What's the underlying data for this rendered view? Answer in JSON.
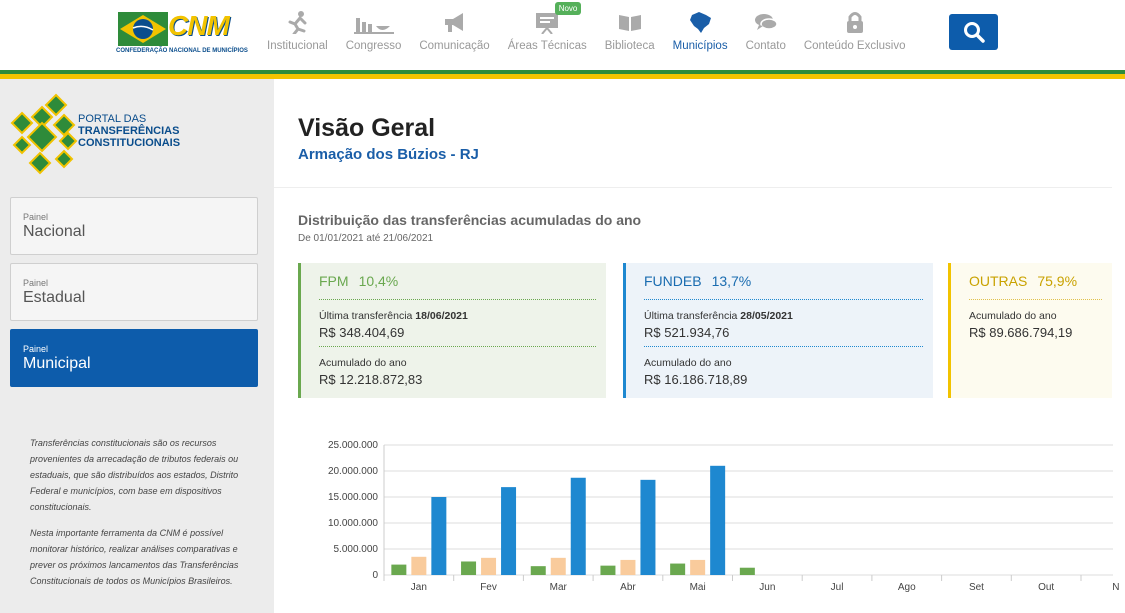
{
  "header": {
    "logo": {
      "text": "CNM",
      "subtitle": "CONFEDERAÇÃO NACIONAL DE MUNICÍPIOS"
    },
    "nav": [
      {
        "label": "Institucional",
        "icon": "person-running-icon"
      },
      {
        "label": "Congresso",
        "icon": "congress-icon"
      },
      {
        "label": "Comunicação",
        "icon": "megaphone-icon"
      },
      {
        "label": "Áreas Técnicas",
        "icon": "presentation-board-icon",
        "badge": "Novo"
      },
      {
        "label": "Biblioteca",
        "icon": "book-icon"
      },
      {
        "label": "Municípios",
        "icon": "brazil-map-icon",
        "active": true
      },
      {
        "label": "Contato",
        "icon": "chat-bubbles-icon"
      },
      {
        "label": "Conteúdo Exclusivo",
        "icon": "lock-icon"
      }
    ],
    "search_icon": "search-icon",
    "colors": {
      "brand_blue": "#0d5cab",
      "green": "#2e8b3a",
      "yellow": "#f2c300"
    }
  },
  "sidebar": {
    "portal": {
      "line1": "PORTAL DAS",
      "line2": "TRANSFERÊNCIAS",
      "line3": "CONSTITUCIONAIS"
    },
    "panels": [
      {
        "small": "Painel",
        "big": "Nacional",
        "active": false
      },
      {
        "small": "Painel",
        "big": "Estadual",
        "active": false
      },
      {
        "small": "Painel",
        "big": "Municipal",
        "active": true
      }
    ],
    "description": [
      "Transferências constitucionais são os recursos provenientes da arrecadação de tributos federais ou estaduais, que são distribuídos aos estados, Distrito Federal e municípios, com base em dispositivos constitucionais.",
      "Nesta importante ferramenta da CNM é possível monitorar histórico, realizar análises comparativas e prever os próximos lancamentos das Transferências Constitucionais de todos os Municípios Brasileiros."
    ]
  },
  "main": {
    "title": "Visão Geral",
    "subtitle": "Armação dos Búzios - RJ",
    "distribution": {
      "title": "Distribuição das transferências acumuladas do ano",
      "period": "De 01/01/2021 até 21/06/2021"
    },
    "cards": {
      "fpm": {
        "name": "FPM",
        "percent": "10,4%",
        "last_label": "Última transferência",
        "last_date": "18/06/2021",
        "last_value": "R$ 348.404,69",
        "acc_label": "Acumulado do ano",
        "acc_value": "R$ 12.218.872,83"
      },
      "fundeb": {
        "name": "FUNDEB",
        "percent": "13,7%",
        "last_label": "Última transferência",
        "last_date": "28/05/2021",
        "last_value": "R$ 521.934,76",
        "acc_label": "Acumulado do ano",
        "acc_value": "R$ 16.186.718,89"
      },
      "outras": {
        "name": "OUTRAS",
        "percent": "75,9%",
        "acc_label": "Acumulado do ano",
        "acc_value": "R$ 89.686.794,19"
      }
    }
  },
  "chart_data": {
    "type": "bar",
    "categories": [
      "Jan",
      "Fev",
      "Mar",
      "Abr",
      "Mai",
      "Jun",
      "Jul",
      "Ago",
      "Set",
      "Out",
      "N"
    ],
    "series": [
      {
        "color": "#6aa84f",
        "values": [
          2000000,
          2600000,
          1700000,
          1800000,
          2200000,
          1400000,
          null,
          null,
          null,
          null,
          null
        ]
      },
      {
        "color": "#f9cb9c",
        "values": [
          3500000,
          3300000,
          3300000,
          2900000,
          2900000,
          null,
          null,
          null,
          null,
          null,
          null
        ]
      },
      {
        "color": "#1e88d0",
        "values": [
          15000000,
          16900000,
          18700000,
          18300000,
          21000000,
          null,
          null,
          null,
          null,
          null,
          null
        ]
      }
    ],
    "y_ticks": [
      "0",
      "5.000.000",
      "10.000.000",
      "15.000.000",
      "20.000.000",
      "25.000.000"
    ],
    "ylim": [
      0,
      25000000
    ],
    "grid": true
  }
}
